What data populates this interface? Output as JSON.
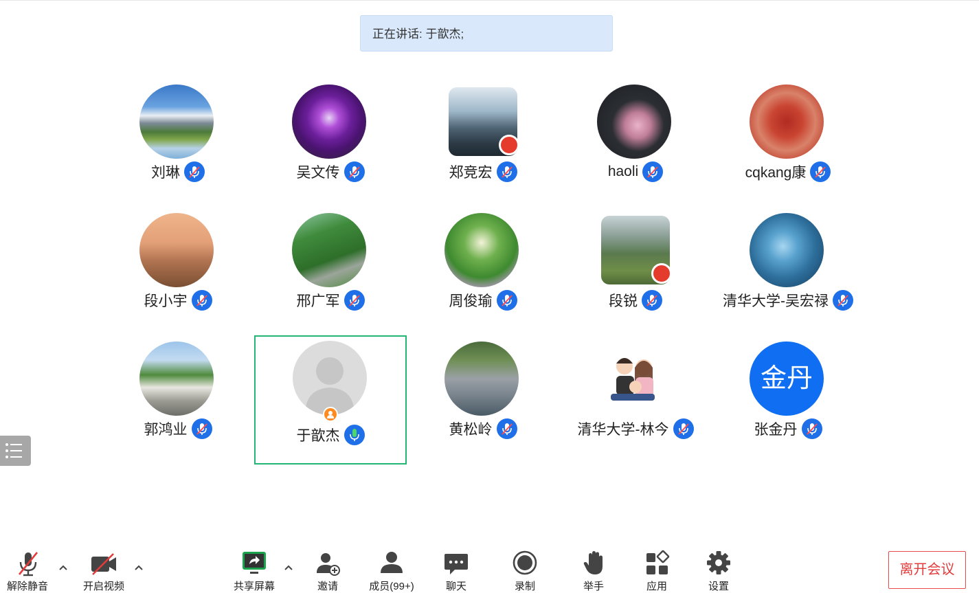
{
  "speaking_banner": "正在讲话: 于歆杰;",
  "participants": [
    {
      "name": "刘琳",
      "initials": ""
    },
    {
      "name": "吴文传",
      "initials": ""
    },
    {
      "name": "郑竞宏",
      "initials": ""
    },
    {
      "name": "haoli",
      "initials": ""
    },
    {
      "name": "cqkang康",
      "initials": ""
    },
    {
      "name": "段小宇",
      "initials": ""
    },
    {
      "name": "邢广军",
      "initials": ""
    },
    {
      "name": "周俊瑜",
      "initials": ""
    },
    {
      "name": "段锐",
      "initials": ""
    },
    {
      "name": "清华大学-吴宏禄",
      "initials": ""
    },
    {
      "name": "郭鸿业",
      "initials": ""
    },
    {
      "name": "于歆杰",
      "initials": ""
    },
    {
      "name": "黄松岭",
      "initials": ""
    },
    {
      "name": "清华大学-林今",
      "initials": ""
    },
    {
      "name": "张金丹",
      "initials": "金丹"
    }
  ],
  "toolbar": {
    "unmute": "解除静音",
    "start_video": "开启视频",
    "share_screen": "共享屏幕",
    "invite": "邀请",
    "members": "成员(99+)",
    "chat": "聊天",
    "record": "录制",
    "raise_hand": "举手",
    "apps": "应用",
    "settings": "设置",
    "leave": "离开会议"
  },
  "colors": {
    "mic_badge": "#1e6fe8",
    "active_border": "#22b573",
    "leave": "#e23c3c",
    "banner": "#d9e9fb"
  }
}
